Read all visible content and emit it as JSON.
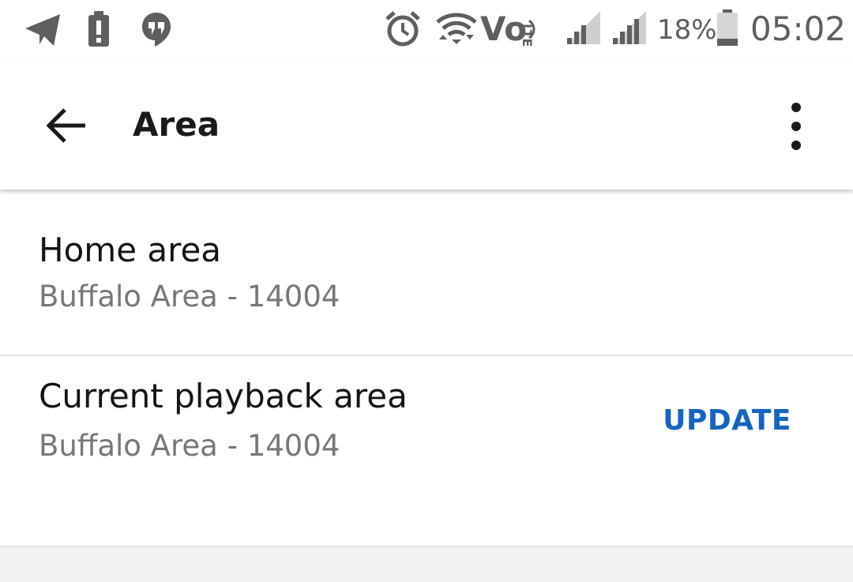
{
  "status_bar": {
    "icons": [
      "telegram-icon",
      "battery-alert-icon",
      "hangouts-icon",
      "alarm-icon",
      "wifi-icon",
      "volte-icon",
      "lte-icon",
      "signal-icon",
      "signal-icon"
    ],
    "volte_label": "Vo",
    "lte_label": "LTE",
    "battery_percent": "18%",
    "time": "05:02"
  },
  "app_bar": {
    "title": "Area",
    "back_icon": "arrow-back-icon",
    "menu_icon": "more-vert-icon"
  },
  "settings": [
    {
      "title": "Home area",
      "subtitle": "Buffalo Area - 14004"
    },
    {
      "title": "Current playback area",
      "subtitle": "Buffalo Area - 14004",
      "action_label": "UPDATE"
    }
  ],
  "colors": {
    "accent": "#1565c0",
    "status_icon": "#5f5f5f",
    "background": "#f2f2f2"
  }
}
